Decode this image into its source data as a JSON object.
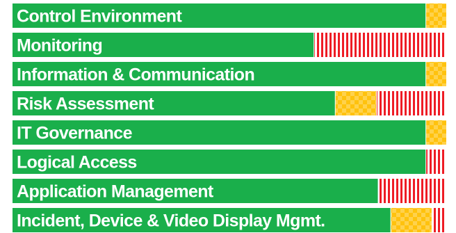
{
  "colors": {
    "green": "#1aaf4b",
    "yellow": "#ffc20e",
    "red": "#ee1c25",
    "white": "#ffffff",
    "divider": "#ffffff"
  },
  "chart_data": {
    "type": "bar",
    "orientation": "horizontal",
    "stacked": true,
    "scale_max": 100,
    "segments": [
      "green",
      "yellow",
      "red"
    ],
    "categories": [
      "Control Environment",
      "Monitoring",
      "Information & Communication",
      "Risk Assessment",
      "IT Governance",
      "Logical Access",
      "Application Management",
      "Incident, Device & Video Display Mgmt."
    ],
    "series": [
      {
        "values": [
          95.3,
          69.5,
          95.3,
          74.4,
          95.3,
          95.3,
          84.3,
          87.2
        ]
      },
      {
        "values": [
          4.7,
          0,
          4.7,
          9.5,
          4.7,
          0,
          0,
          9.5
        ]
      },
      {
        "values": [
          0,
          30.5,
          0,
          16.1,
          0,
          4.7,
          15.7,
          3.3
        ]
      }
    ],
    "grid": false,
    "legend": "none"
  }
}
